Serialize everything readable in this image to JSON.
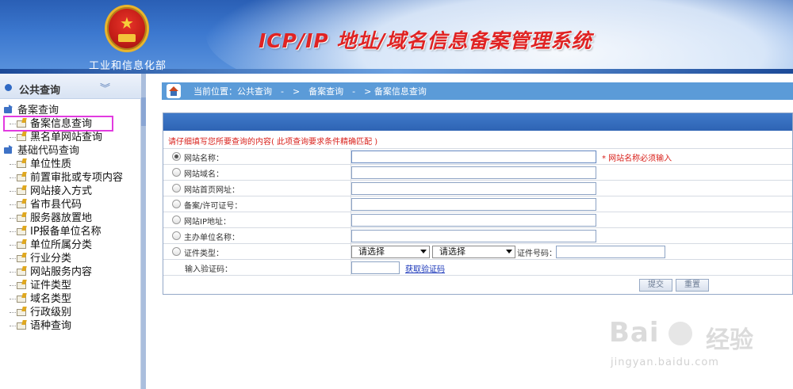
{
  "header": {
    "ministry_name": "工业和信息化部",
    "site_title": "ICP/IP 地址/域名信息备案管理系统"
  },
  "sidebar": {
    "section_title": "公共查询",
    "groups": [
      {
        "label": "备案查询",
        "items": [
          {
            "label": "备案信息查询",
            "selected": true
          },
          {
            "label": "黑名单网站查询",
            "selected": false
          }
        ]
      },
      {
        "label": "基础代码查询",
        "items": [
          {
            "label": "单位性质"
          },
          {
            "label": "前置审批或专项内容"
          },
          {
            "label": "网站接入方式"
          },
          {
            "label": "省市县代码"
          },
          {
            "label": "服务器放置地"
          },
          {
            "label": "IP报备单位名称"
          },
          {
            "label": "单位所属分类"
          },
          {
            "label": "行业分类"
          },
          {
            "label": "网站服务内容"
          },
          {
            "label": "证件类型"
          },
          {
            "label": "域名类型"
          },
          {
            "label": "行政级别"
          },
          {
            "label": "语种查询"
          }
        ]
      }
    ]
  },
  "breadcrumb": {
    "text": "当前位置：公共查询　-　>　备案查询　-　> 备案信息查询"
  },
  "form": {
    "hint": "请仔细填写您所要查询的内容( 此项查询要求条件精确匹配 )",
    "fields": [
      {
        "label": "网站名称：",
        "value": "",
        "selected": true,
        "required_note": "* 网站名称必须输入"
      },
      {
        "label": "网站域名：",
        "value": "",
        "selected": false
      },
      {
        "label": "网站首页网址：",
        "value": "",
        "selected": false
      },
      {
        "label": "备案/许可证号：",
        "value": "",
        "selected": false
      },
      {
        "label": "网站IP地址：",
        "value": "",
        "selected": false
      },
      {
        "label": "主办单位名称：",
        "value": "",
        "selected": false
      }
    ],
    "cert": {
      "label": "证件类型：",
      "select1": "请选择",
      "select2": "请选择",
      "number_label": "证件号码：",
      "number_value": ""
    },
    "captcha": {
      "label": "输入验证码：",
      "value": "",
      "link": "获取验证码"
    },
    "buttons": {
      "submit": "提交",
      "reset": "重置"
    }
  },
  "watermark": {
    "brand": "Bai",
    "brand2": "经验",
    "url": "jingyan.baidu.com"
  },
  "colors": {
    "header_blue": "#2a5fb5",
    "title_red": "#e02323",
    "breadcrumb_blue": "#5b9bd8",
    "panel_bar_blue": "#2e63b4",
    "required_red": "#d9221c",
    "selection_magenta": "#e23be0",
    "link_blue": "#1633b8"
  }
}
